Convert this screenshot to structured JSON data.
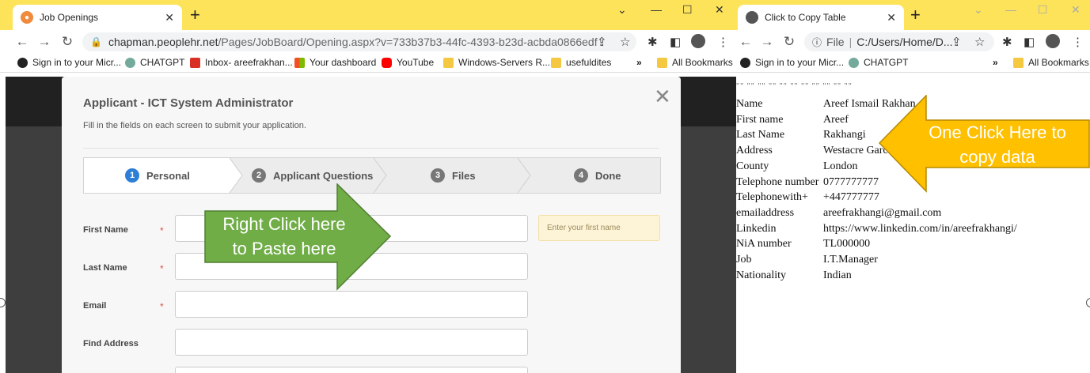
{
  "left_browser": {
    "tab_title": "Job Openings",
    "url_host": "chapman.peoplehr.net",
    "url_path": "/Pages/JobBoard/Opening.aspx?v=733b37b3-44fc-4393-b23d-acbda0866edf",
    "bookmarks": [
      "Sign in to your Micr...",
      "CHATGPT",
      "Inbox- areefrakhan...",
      "Your dashboard",
      "YouTube",
      "Windows-Servers R...",
      "usefuldites"
    ],
    "bookmarks_more": "»",
    "all_bookmarks": "All Bookmarks"
  },
  "right_browser": {
    "tab_title": "Click to Copy Table",
    "url_scheme": "File",
    "url_path": "C:/Users/Home/D...",
    "bookmarks": [
      "Sign in to your Micr...",
      "CHATGPT"
    ],
    "bookmarks_more": "»",
    "all_bookmarks": "All Bookmarks"
  },
  "modal": {
    "title": "Applicant - ICT System Administrator",
    "subtitle": "Fill in the fields on each screen to submit your application.",
    "steps": [
      {
        "num": "1",
        "label": "Personal"
      },
      {
        "num": "2",
        "label": "Applicant Questions"
      },
      {
        "num": "3",
        "label": "Files"
      },
      {
        "num": "4",
        "label": "Done"
      }
    ],
    "fields": [
      {
        "label": "First Name",
        "required": "*"
      },
      {
        "label": "Last Name",
        "required": "*"
      },
      {
        "label": "Email",
        "required": "*"
      },
      {
        "label": "Find Address",
        "required": ""
      }
    ],
    "first_name_hint": "Enter your first name"
  },
  "copy_table": {
    "quotes_line": "\"\" \"\" \"\" \"\" \"\" \"\" \"\" \"\" \"\" \"\" \"\"",
    "rows": [
      {
        "key": "Name",
        "value": "Areef Ismail Rakhan"
      },
      {
        "key": "First name",
        "value": "Areef"
      },
      {
        "key": "Last Name",
        "value": "Rakhangi"
      },
      {
        "key": "Address",
        "value": "Westacre Garc"
      },
      {
        "key": "County",
        "value": "London"
      },
      {
        "key": "Telephone number",
        "value": "0777777777"
      },
      {
        "key": "Telephonewith+",
        "value": "+447777777"
      },
      {
        "key": "emailaddress",
        "value": "areefrakhangi@gmail.com"
      },
      {
        "key": "Linkedin",
        "value": "https://www.linkedin.com/in/areefrakhangi/"
      },
      {
        "key": "NiA number",
        "value": "TL000000"
      },
      {
        "key": "Job",
        "value": "I.T.Manager"
      },
      {
        "key": "Nationality",
        "value": "Indian"
      }
    ]
  },
  "callouts": {
    "paste_line1": "Right Click here",
    "paste_line2": "to Paste here",
    "copy_line1": "One Click Here to",
    "copy_line2": "copy data",
    "green": "#70ad47",
    "orange": "#ffc000"
  },
  "colors": {
    "tabstrip": "#fde35a",
    "step_active": "#2d7ed6"
  }
}
